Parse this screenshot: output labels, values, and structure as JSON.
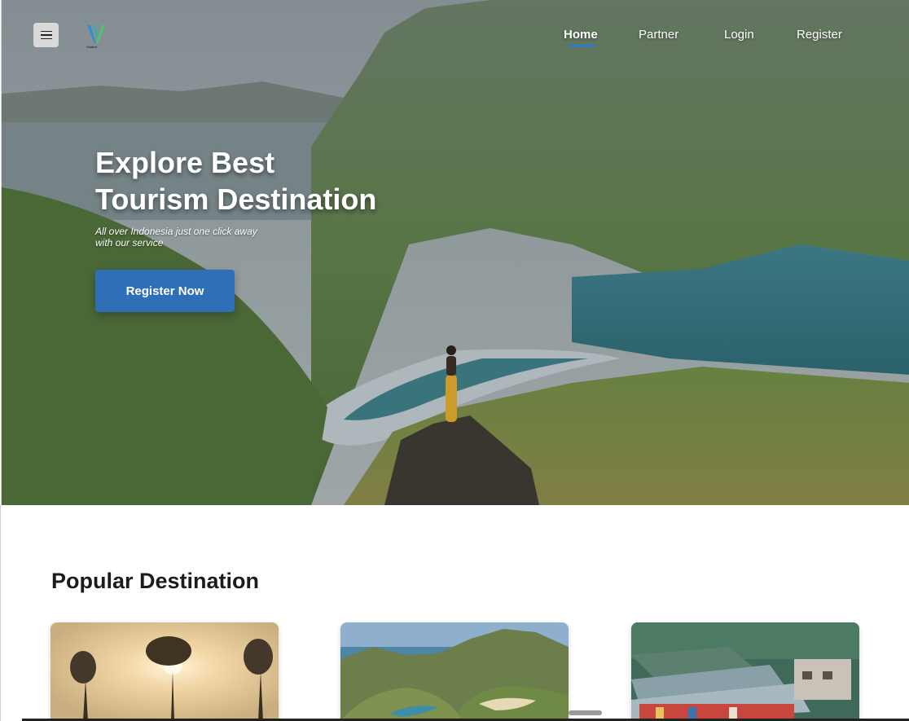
{
  "header": {
    "menu_icon": "hamburger-menu-icon",
    "logo_text": "Visited",
    "nav": [
      {
        "label": "Home",
        "active": true
      },
      {
        "label": "Partner",
        "active": false
      },
      {
        "label": "Login",
        "active": false
      },
      {
        "label": "Register",
        "active": false
      }
    ],
    "accent_color": "#2b7bd1"
  },
  "hero": {
    "title_line1": "Explore Best",
    "title_line2": "Tourism Destination",
    "subtitle_line1": "All over Indonesia just one click away",
    "subtitle_line2": "with our service",
    "cta_label": "Register Now",
    "cta_color": "#2f6fb8"
  },
  "popular": {
    "title": "Popular Destination"
  }
}
